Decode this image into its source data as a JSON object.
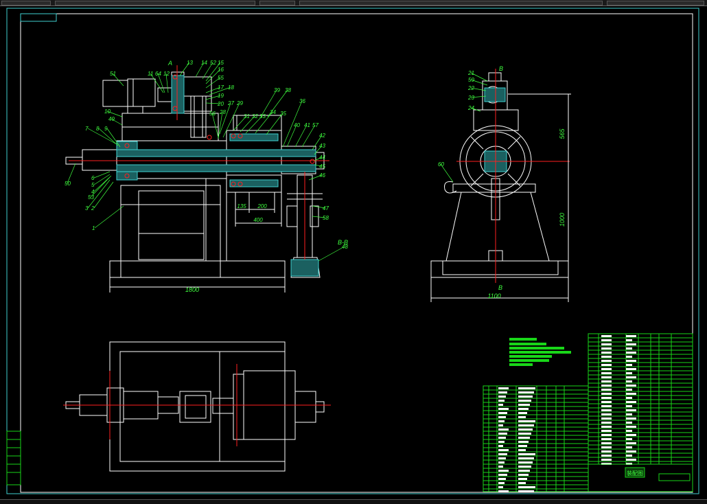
{
  "drawing": {
    "side_view": {
      "part_labels": [
        "51",
        "11",
        "64",
        "12",
        "13",
        "14",
        "52",
        "15",
        "16",
        "55",
        "17",
        "18",
        "10",
        "49",
        "7",
        "8",
        "9",
        "50",
        "6",
        "5",
        "53",
        "4",
        "3",
        "2",
        "1",
        "56",
        "27",
        "29",
        "28",
        "31",
        "32",
        "33",
        "34",
        "35",
        "36",
        "39",
        "38",
        "40",
        "41",
        "57",
        "42",
        "43",
        "44",
        "45",
        "46",
        "47",
        "58",
        "48",
        "19",
        "20"
      ],
      "section_mark_top": "A",
      "section_label": "B-B",
      "dims": {
        "overall_length": "1800",
        "d1": "135",
        "d2": "200",
        "d3": "400"
      }
    },
    "end_view": {
      "part_labels": [
        "21",
        "59",
        "22",
        "23",
        "24",
        "60"
      ],
      "section_mark_top": "B",
      "section_mark_bottom": "B",
      "dims": {
        "upper_height": "565",
        "base_height": "1000",
        "width": "1100"
      }
    },
    "title_block": {
      "title": "装配图"
    }
  },
  "colors": {
    "frame": "#3fd0d0",
    "lines": "#ffffff",
    "labels": "#3fff3f",
    "center": "#ff2020",
    "hatch": "#3fd0d0",
    "notes": "#19d619"
  }
}
